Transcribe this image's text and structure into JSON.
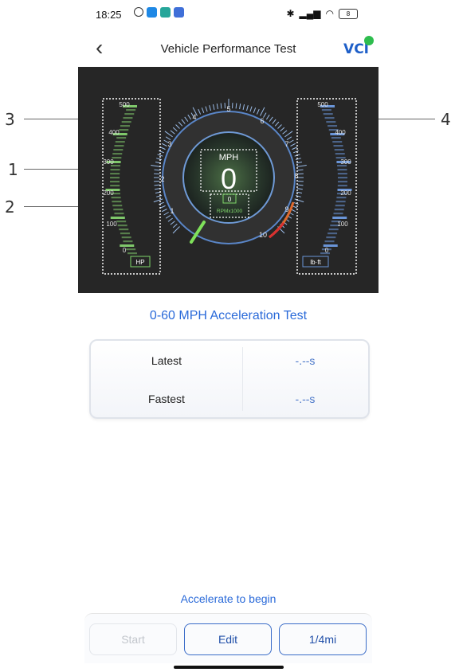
{
  "callouts": [
    {
      "num": "3",
      "side": "left"
    },
    {
      "num": "1",
      "side": "left"
    },
    {
      "num": "2",
      "side": "left"
    },
    {
      "num": "4",
      "side": "right"
    }
  ],
  "status": {
    "time": "18:25",
    "battery": "8"
  },
  "header": {
    "title": "Vehicle Performance Test",
    "logo": "VCI",
    "back_icon": "chevron-left-icon"
  },
  "gauge": {
    "speed_unit": "MPH",
    "speed_value": "0",
    "rpm_value": "0",
    "rpm_unit": "RPMx1000",
    "rpm_ticks": [
      "1",
      "2",
      "3",
      "4",
      "5",
      "6",
      "7",
      "8",
      "9",
      "10"
    ],
    "hp_unit": "HP",
    "hp_ticks": [
      "500",
      "400",
      "300",
      "200",
      "100",
      "0"
    ],
    "torque_unit": "lb·ft",
    "torque_ticks": [
      "500",
      "400",
      "300",
      "200",
      "100",
      "0"
    ]
  },
  "test": {
    "title": "0-60 MPH Acceleration Test",
    "results": [
      {
        "label": "Latest",
        "value": "-.--s"
      },
      {
        "label": "Fastest",
        "value": "-.--s"
      }
    ],
    "hint": "Accelerate to begin"
  },
  "buttons": {
    "start": "Start",
    "edit": "Edit",
    "distance": "1/4mi"
  },
  "colors": {
    "accent": "#2a6ad9",
    "dash_bg": "#262626",
    "hp_green": "#7fc96b",
    "torque_blue": "#6a95d8"
  }
}
